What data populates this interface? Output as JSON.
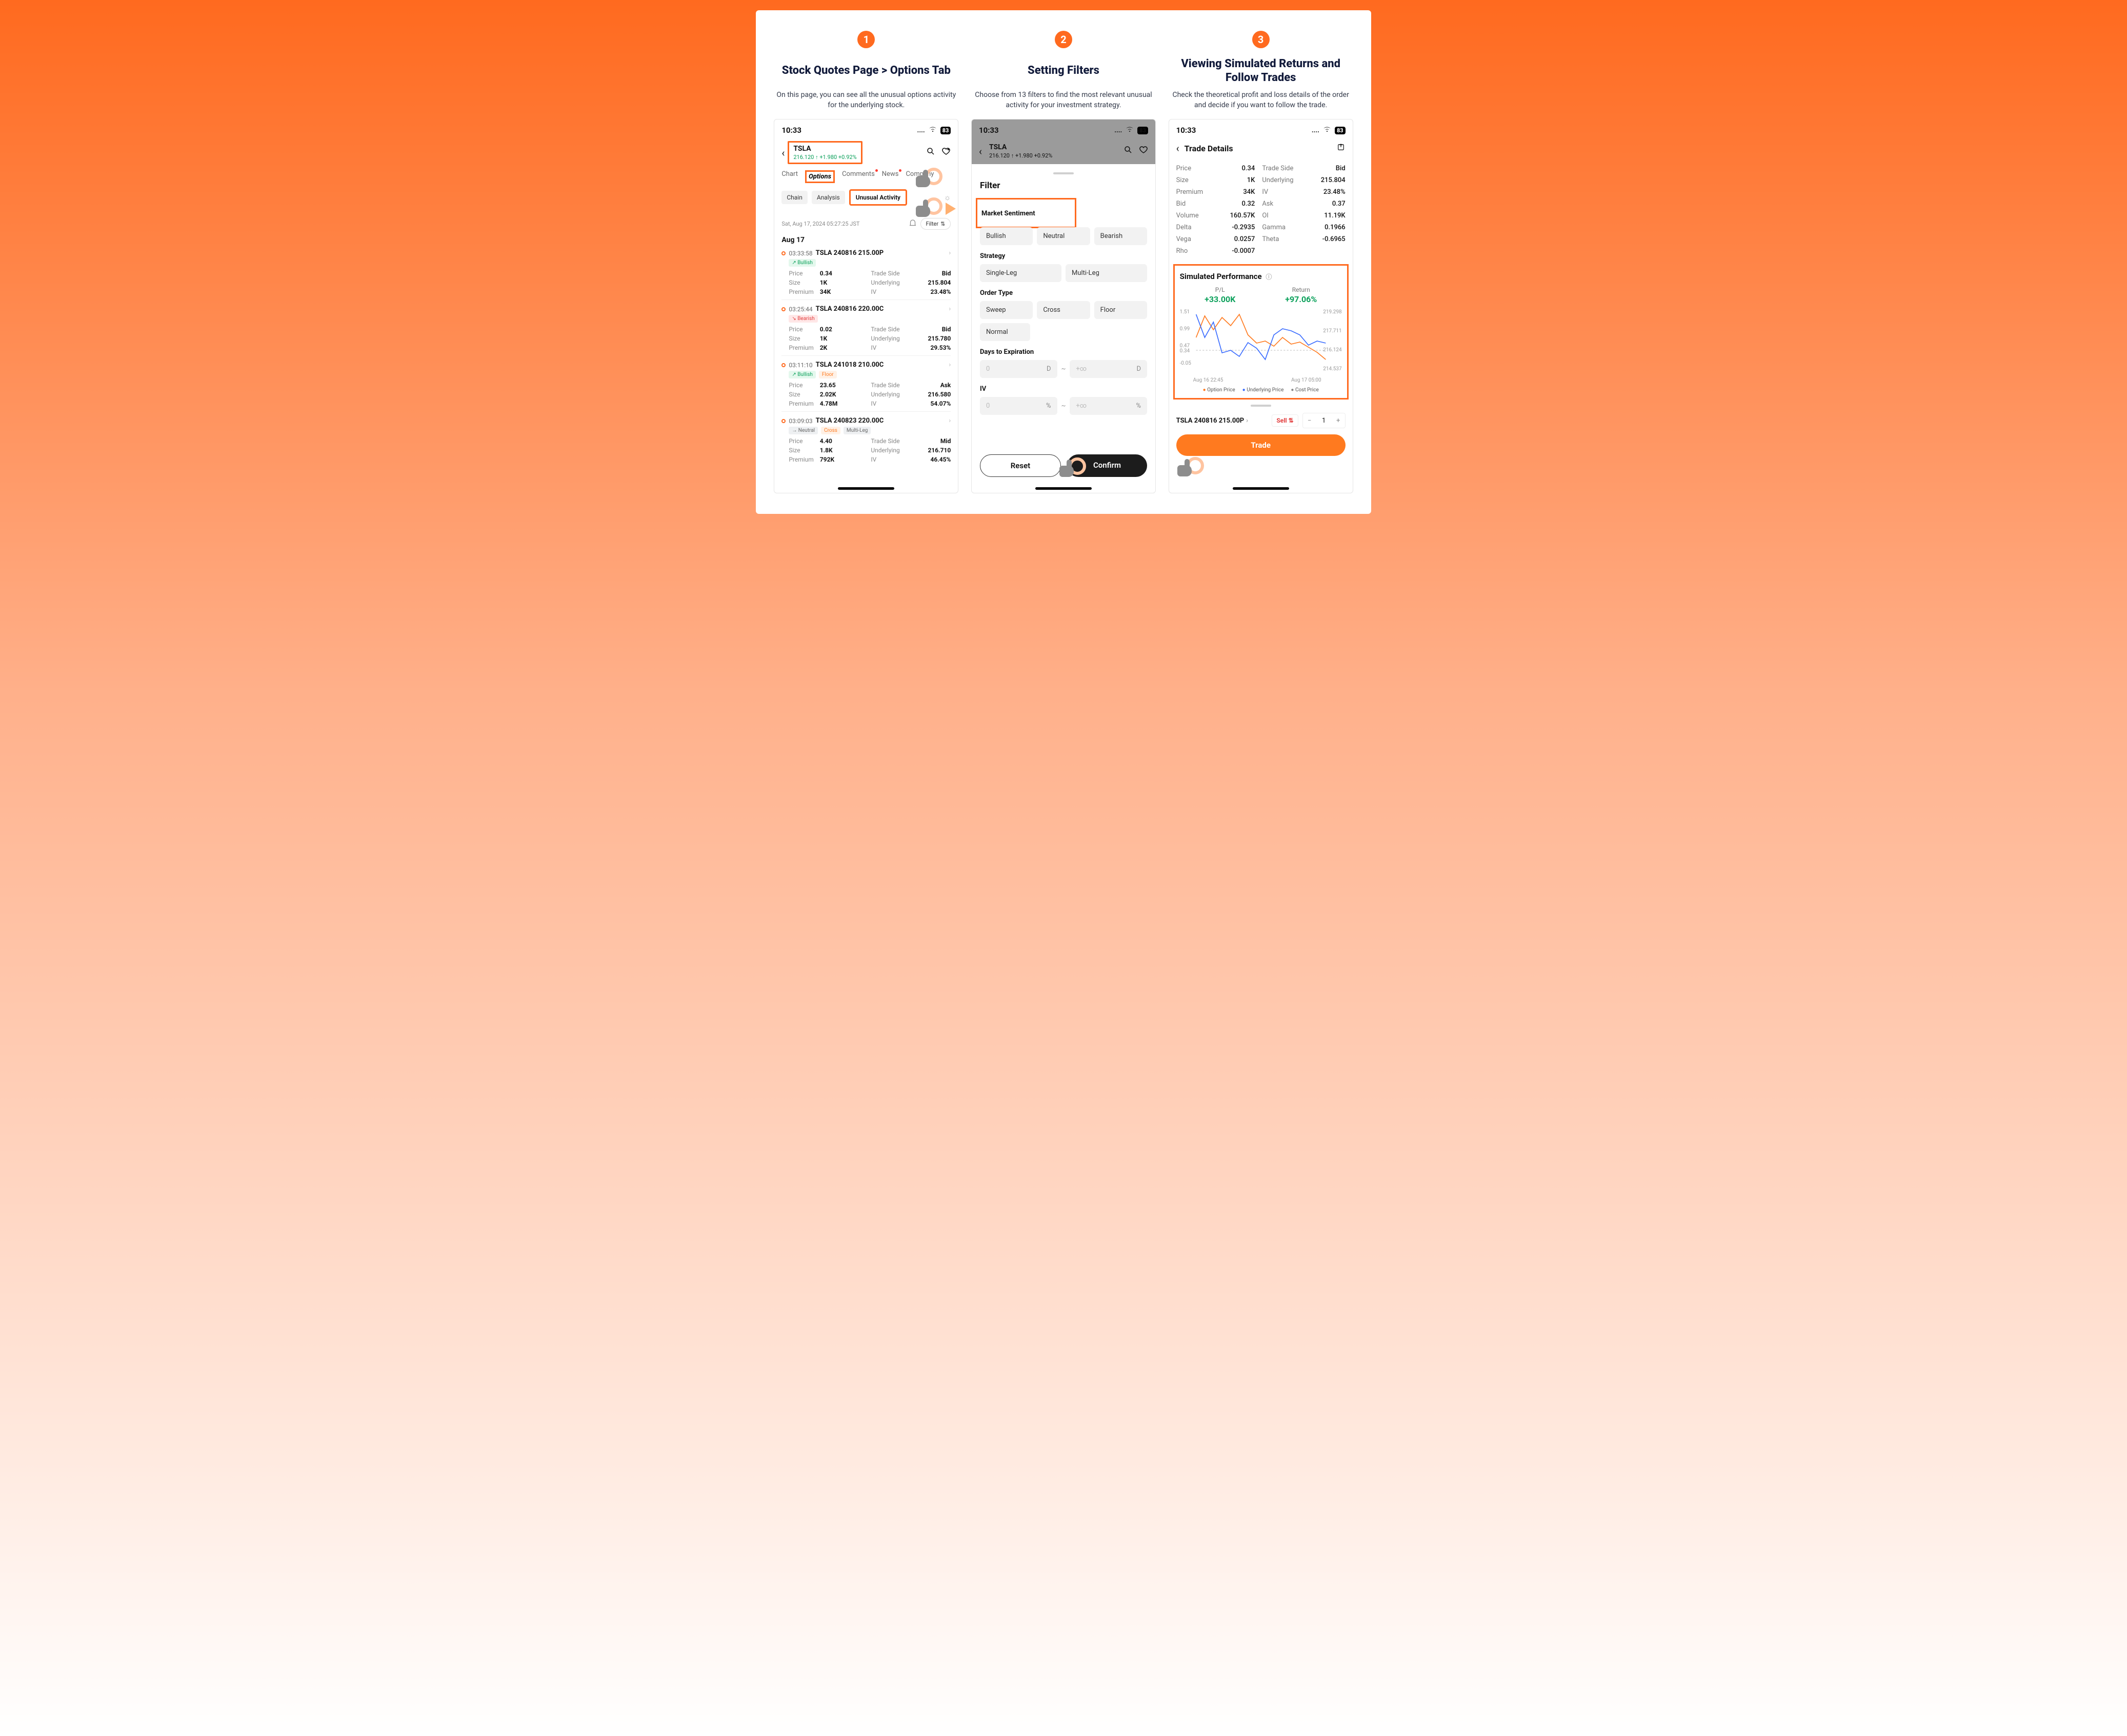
{
  "steps": [
    {
      "num": "1",
      "title": "Stock Quotes Page > Options Tab",
      "desc": "On this page, you can see all the unusual options activity for the underlying stock."
    },
    {
      "num": "2",
      "title": "Setting Filters",
      "desc": "Choose from 13 filters to find the most relevant unusual activity for your investment strategy."
    },
    {
      "num": "3",
      "title": "Viewing Simulated Returns and Follow Trades",
      "desc": "Check the theoretical profit and loss details of the order and decide if you want to follow the trade."
    }
  ],
  "status": {
    "time": "10:33",
    "signal": "....",
    "battery": "83"
  },
  "ticker": {
    "symbol": "TSLA",
    "price": "216.120",
    "change": "+1.980",
    "pct": "+0.92%"
  },
  "tabs": [
    "Chart",
    "Options",
    "Comments",
    "News",
    "Company"
  ],
  "subtabs": [
    "Chain",
    "Analysis",
    "Unusual Activity"
  ],
  "meta": {
    "timestamp": "Sat, Aug 17, 2024 05:27:25 JST",
    "filter_label": "Filter"
  },
  "date_heading": "Aug 17",
  "entries": [
    {
      "time": "03:33:58",
      "title": "TSLA 240816 215.00P",
      "tags": [
        {
          "t": "Bullish",
          "c": "bull"
        }
      ],
      "price": "0.34",
      "side": "Bid",
      "size": "1K",
      "underlying": "215.804",
      "premium": "34K",
      "iv": "23.48%"
    },
    {
      "time": "03:25:44",
      "title": "TSLA 240816 220.00C",
      "tags": [
        {
          "t": "Bearish",
          "c": "bear"
        }
      ],
      "price": "0.02",
      "side": "Bid",
      "size": "1K",
      "underlying": "215.780",
      "premium": "2K",
      "iv": "29.53%"
    },
    {
      "time": "03:11:10",
      "title": "TSLA 241018 210.00C",
      "tags": [
        {
          "t": "Bullish",
          "c": "bull"
        },
        {
          "t": "Floor",
          "c": "floor"
        }
      ],
      "price": "23.65",
      "side": "Ask",
      "size": "2.02K",
      "underlying": "216.580",
      "premium": "4.78M",
      "iv": "54.07%"
    },
    {
      "time": "03:09:03",
      "title": "TSLA 240823 220.00C",
      "tags": [
        {
          "t": "Neutral",
          "c": "neutral"
        },
        {
          "t": "Cross",
          "c": "cross"
        },
        {
          "t": "Multi-Leg",
          "c": "ml"
        }
      ],
      "price": "4.40",
      "side": "Mid",
      "size": "1.8K",
      "underlying": "216.710",
      "premium": "792K",
      "iv": "46.45%"
    }
  ],
  "kv_labels": {
    "price": "Price",
    "side": "Trade Side",
    "size": "Size",
    "underlying": "Underlying",
    "premium": "Premium",
    "iv": "IV"
  },
  "filter_sheet": {
    "title": "Filter",
    "sections": {
      "sentiment": {
        "label": "Market Sentiment",
        "opts": [
          "Bullish",
          "Neutral",
          "Bearish"
        ]
      },
      "strategy": {
        "label": "Strategy",
        "opts": [
          "Single-Leg",
          "Multi-Leg"
        ]
      },
      "order": {
        "label": "Order Type",
        "opts": [
          "Sweep",
          "Cross",
          "Floor",
          "Normal"
        ]
      },
      "dte": {
        "label": "Days to Expiration",
        "from_ph": "0",
        "from_unit": "D",
        "to_ph": "+∞",
        "to_unit": "D"
      },
      "iv": {
        "label": "IV",
        "from_ph": "0",
        "from_unit": "%",
        "to_ph": "+∞",
        "to_unit": "%"
      }
    },
    "reset": "Reset",
    "confirm": "Confirm"
  },
  "trade_details": {
    "title": "Trade Details",
    "rows": [
      [
        "Price",
        "0.34",
        "Trade Side",
        "Bid"
      ],
      [
        "Size",
        "1K",
        "Underlying",
        "215.804"
      ],
      [
        "Premium",
        "34K",
        "IV",
        "23.48%"
      ],
      [
        "Bid",
        "0.32",
        "Ask",
        "0.37"
      ],
      [
        "Volume",
        "160.57K",
        "OI",
        "11.19K"
      ],
      [
        "Delta",
        "-0.2935",
        "Gamma",
        "0.1966"
      ],
      [
        "Vega",
        "0.0257",
        "Theta",
        "-0.6965"
      ],
      [
        "Rho",
        "-0.0007",
        "",
        ""
      ]
    ]
  },
  "sim": {
    "title": "Simulated Performance",
    "pl_label": "P/L",
    "pl_value": "+33.00K",
    "ret_label": "Return",
    "ret_value": "+97.06%",
    "y_left": [
      "1.51",
      "0.99",
      "0.47",
      "0.34",
      "-0.05"
    ],
    "y_right": [
      "219.298",
      "217.711",
      "216.124",
      "214.537"
    ],
    "x": [
      "Aug 16 22:45",
      "Aug 17 05:00"
    ],
    "legend": {
      "opt": "Option Price",
      "und": "Underlying Price",
      "cost": "Cost Price"
    }
  },
  "order_bar": {
    "contract": "TSLA 240816 215.00P",
    "action": "Sell",
    "qty": "1",
    "trade": "Trade"
  },
  "chart_data": {
    "type": "line",
    "title": "Simulated Performance",
    "x_range": [
      "Aug 16 22:45",
      "Aug 17 05:00"
    ],
    "left_axis": {
      "label": "Option Price",
      "range": [
        -0.05,
        1.51
      ],
      "ticks": [
        1.51,
        0.99,
        0.47,
        0.34,
        -0.05
      ]
    },
    "right_axis": {
      "label": "Underlying Price",
      "range": [
        214.537,
        219.298
      ],
      "ticks": [
        219.298,
        217.711,
        216.124,
        214.537
      ]
    },
    "series": [
      {
        "name": "Option Price",
        "axis": "left",
        "color": "#ff7a1f",
        "values": [
          0.7,
          1.35,
          0.9,
          1.3,
          1.05,
          1.4,
          0.8,
          0.55,
          0.6,
          0.45,
          0.7,
          0.5,
          0.55,
          0.4,
          0.25,
          0.1
        ]
      },
      {
        "name": "Underlying Price",
        "axis": "right",
        "color": "#3a6cff",
        "values": [
          218.9,
          217.0,
          218.2,
          215.6,
          215.8,
          215.2,
          216.4,
          215.9,
          215.0,
          216.9,
          217.4,
          217.2,
          216.8,
          216.0,
          216.3,
          216.1
        ]
      },
      {
        "name": "Cost Price",
        "axis": "left",
        "color": "#888",
        "values": [
          0.34,
          0.34,
          0.34,
          0.34,
          0.34,
          0.34,
          0.34,
          0.34,
          0.34,
          0.34,
          0.34,
          0.34,
          0.34,
          0.34,
          0.34,
          0.34
        ]
      }
    ]
  }
}
